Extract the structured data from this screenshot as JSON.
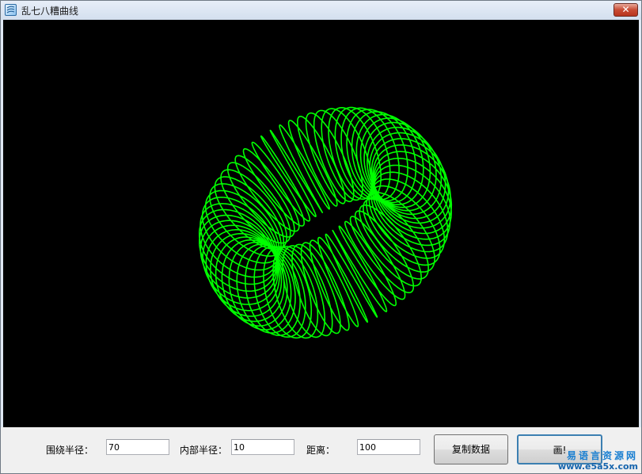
{
  "window": {
    "title": "乱七八糟曲线",
    "close_glyph": "✕",
    "icon": "app-logo-icon"
  },
  "canvas": {
    "background": "#000000",
    "curve_color": "#00ff00"
  },
  "controls": {
    "outer_radius_label": "围绕半径：",
    "outer_radius_value": "70",
    "inner_radius_label": "内部半径：",
    "inner_radius_value": "10",
    "distance_label": "距离：",
    "distance_value": "100",
    "copy_button_label": "复制数据",
    "draw_button_label": "画!"
  },
  "watermark": {
    "line1": "易语言资源网",
    "line2": "www.e5a5x.com"
  }
}
